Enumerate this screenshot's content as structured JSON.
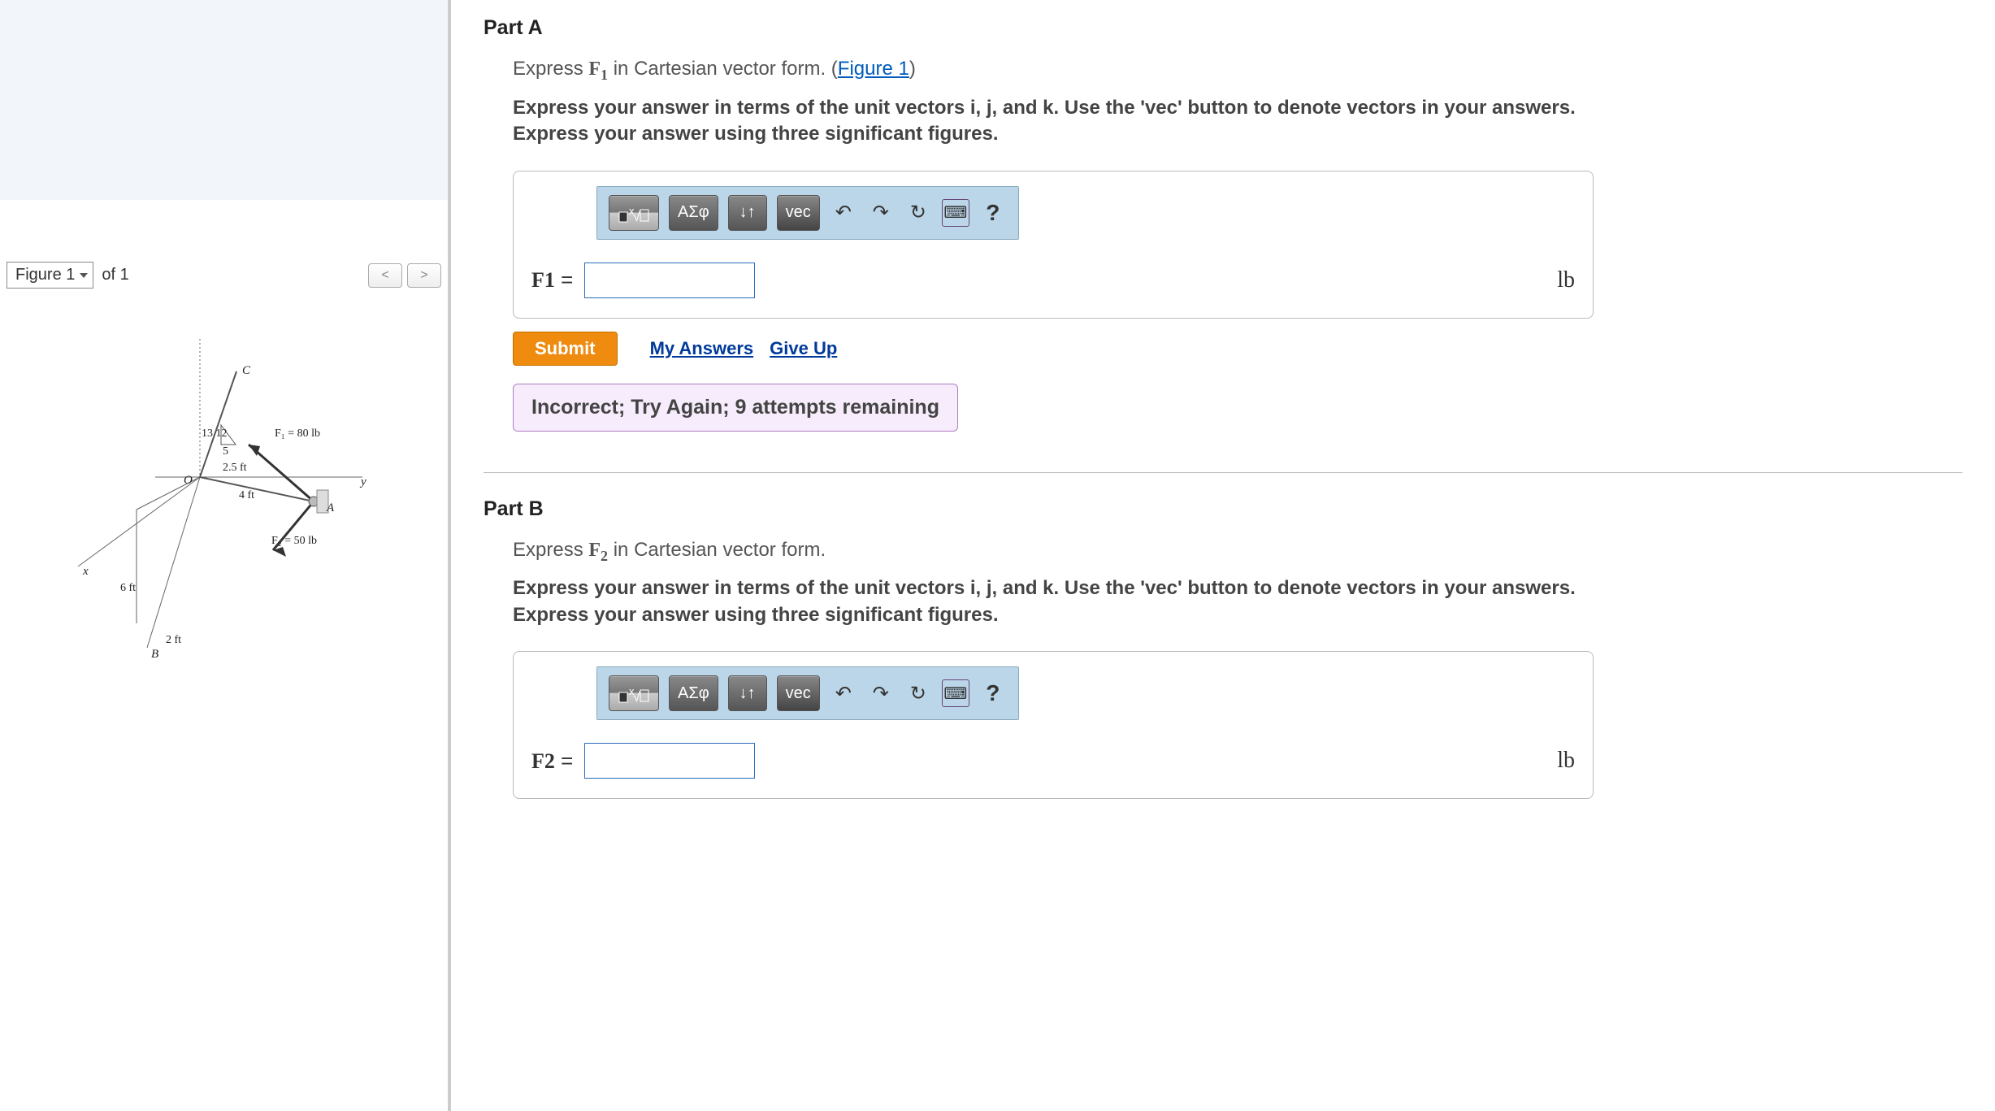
{
  "figureNav": {
    "selectLabel": "Figure 1",
    "ofText": "of 1",
    "prev": "<",
    "next": ">"
  },
  "figure": {
    "labels": {
      "C": "C",
      "O": "O",
      "A": "A",
      "B": "B",
      "x": "x",
      "y": "y",
      "tri": "13  12",
      "triBottom": "5",
      "d1": "2.5 ft",
      "d2": "4 ft",
      "d3": "6 ft",
      "d4": "2 ft",
      "F1": "F₁ = 80 lb",
      "F2": "F₂ = 50 lb"
    }
  },
  "partA": {
    "title": "Part A",
    "promptPrefix": "Express ",
    "forceSymbol": "F",
    "forceSub": "1",
    "promptSuffix": " in Cartesian vector form. (",
    "figLink": "Figure 1",
    "promptClose": ")",
    "instructions": "Express your answer in terms of the unit vectors i, j, and k. Use the 'vec' button to denote vectors in your answers. Express your answer using three significant figures.",
    "answerLabelSymbol": "F",
    "answerLabelSub": "1",
    "equals": " = ",
    "unit": "lb",
    "feedback": "Incorrect; Try Again; 9 attempts remaining"
  },
  "partB": {
    "title": "Part B",
    "promptPrefix": "Express ",
    "forceSymbol": "F",
    "forceSub": "2",
    "promptSuffix": " in Cartesian vector form.",
    "instructions": "Express your answer in terms of the unit vectors i, j, and k. Use the 'vec' button to denote vectors in your answers. Express your answer using three significant figures.",
    "answerLabelSymbol": "F",
    "answerLabelSub": "2",
    "equals": " = ",
    "unit": "lb"
  },
  "toolbar": {
    "templates": "▯√▯",
    "greek": "ΑΣφ",
    "subsup": "↓↑",
    "vec": "vec",
    "undo": "↶",
    "redo": "↷",
    "reset": "↻",
    "keyboard": "⌨",
    "help": "?"
  },
  "actions": {
    "submit": "Submit",
    "myAnswers": "My Answers",
    "giveUp": "Give Up"
  }
}
